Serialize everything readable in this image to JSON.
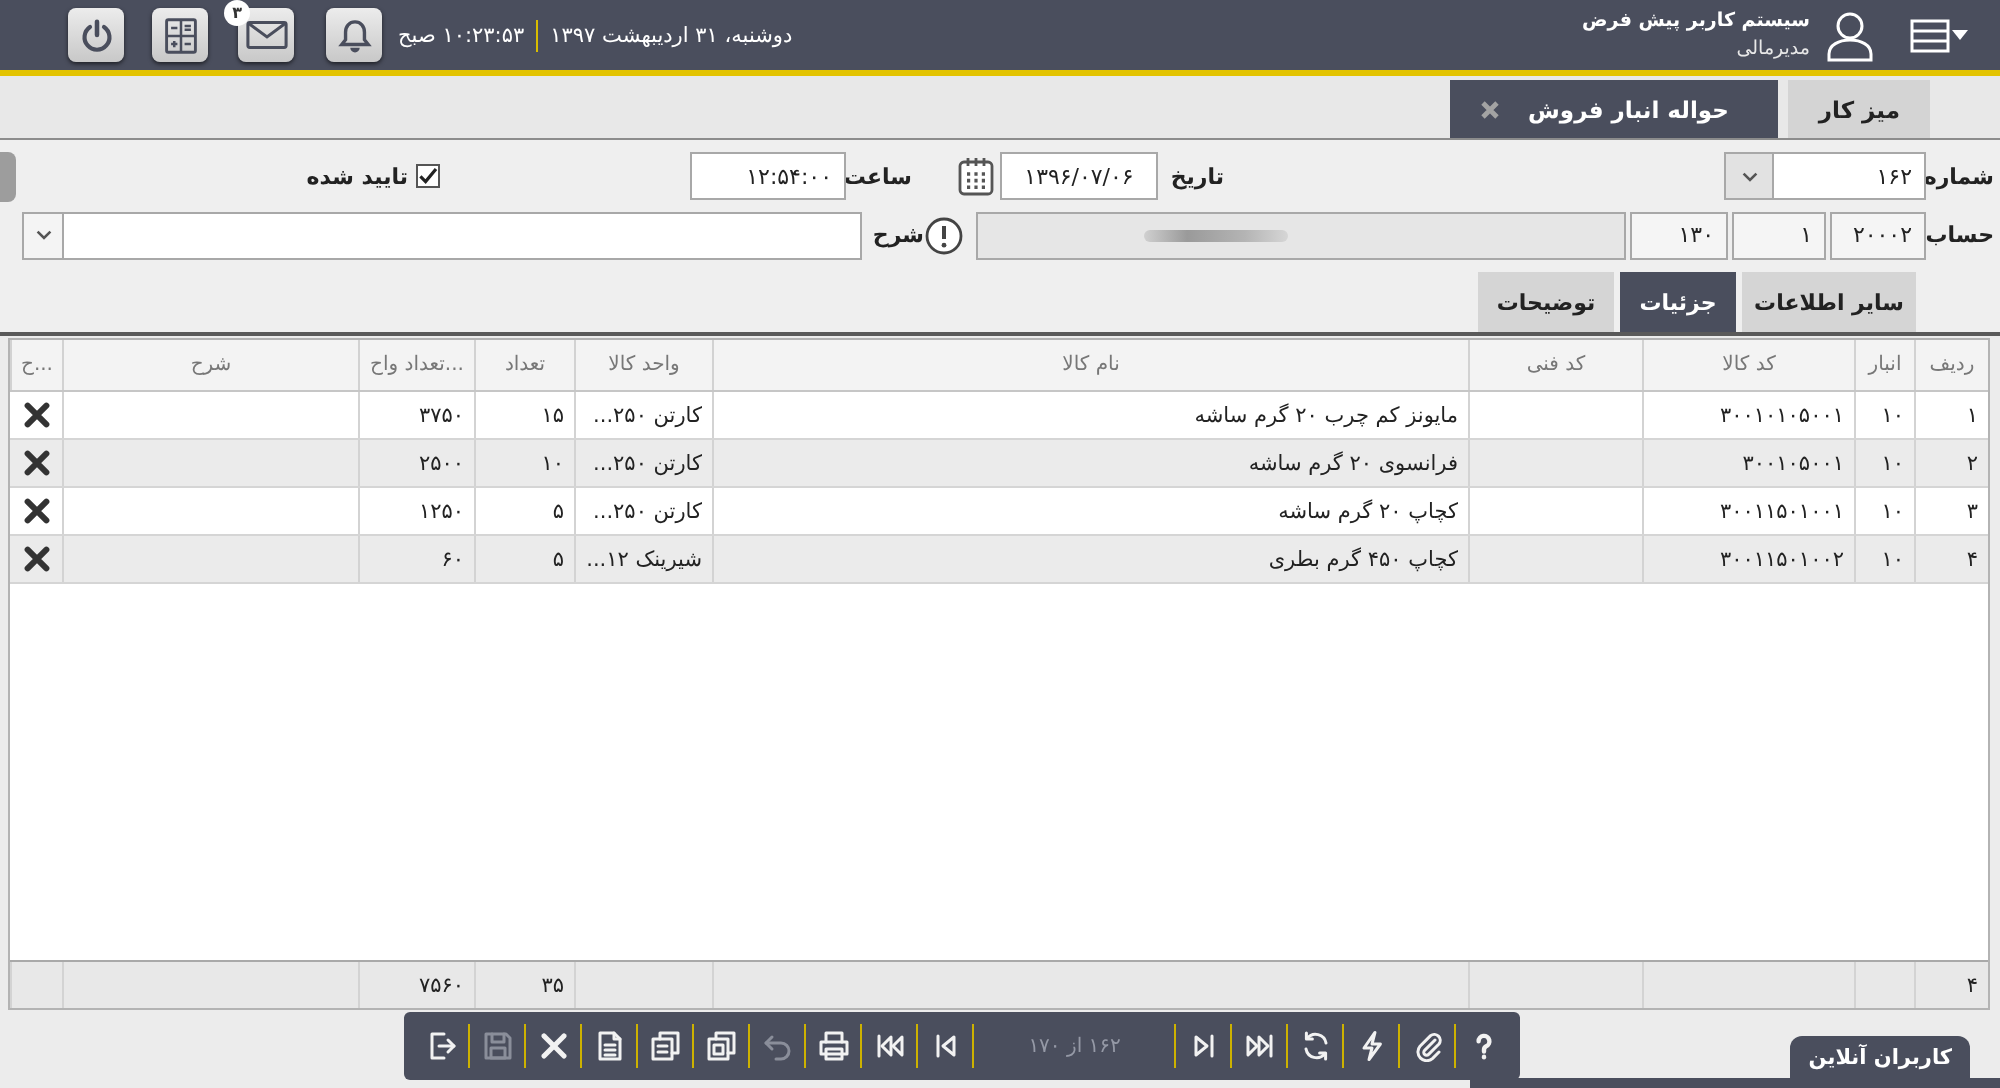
{
  "header": {
    "user_name": "سیستم کاربر پیش فرض",
    "user_role": "مدیرمالی",
    "date": "دوشنبه، ۳۱ اردیبهشت ۱۳۹۷",
    "time": "۱۰:۲۳:۵۳ صبح",
    "mail_badge": "۳"
  },
  "main_tabs": [
    {
      "label": "میز کار",
      "selected": false,
      "closable": false
    },
    {
      "label": "حواله انبار فروش",
      "selected": true,
      "closable": true
    }
  ],
  "form": {
    "number": {
      "label": "شماره",
      "value": "۱۶۲"
    },
    "date": {
      "label": "تاریخ",
      "value": "۱۳۹۶/۰۷/۰۶"
    },
    "time": {
      "label": "ساعت",
      "value": "۱۲:۵۴:۰۰"
    },
    "approved": {
      "label": "تایید شده",
      "checked": true
    },
    "account": {
      "label": "حساب",
      "codes": [
        "۲۰۰۰۲",
        "۱",
        "۱۳۰"
      ]
    },
    "description": {
      "label": "شرح"
    }
  },
  "detail_tabs": [
    {
      "label": "سایر اطلاعات",
      "selected": false
    },
    {
      "label": "جزئیات",
      "selected": true
    },
    {
      "label": "توضیحات",
      "selected": false
    }
  ],
  "table": {
    "columns": [
      "ردیف",
      "انبار",
      "کد کالا",
      "کد فنی",
      "نام کالا",
      "واحد کالا",
      "تعداد",
      "تعداد واح...",
      "شرح",
      "ح..."
    ],
    "rows": [
      {
        "row": "۱",
        "warehouse": "۱۰",
        "item_code": "۳۰۰۱۰۱۰۵۰۰۱",
        "item_name": "مایونز کم چرب ۲۰ گرم ساشه",
        "unit": "کارتن ۲۵۰...",
        "quantity": "۱۵",
        "unit_count": "۳۷۵۰"
      },
      {
        "row": "۲",
        "warehouse": "۱۰",
        "item_code": "۳۰۰۱۰۵۰۰۱",
        "item_name": "فرانسوی ۲۰ گرم ساشه",
        "unit": "کارتن ۲۵۰...",
        "quantity": "۱۰",
        "unit_count": "۲۵۰۰"
      },
      {
        "row": "۳",
        "warehouse": "۱۰",
        "item_code": "۳۰۰۱۱۵۰۱۰۰۱",
        "item_name": "کچاپ ۲۰ گرم ساشه",
        "unit": "کارتن ۲۵۰...",
        "quantity": "۵",
        "unit_count": "۱۲۵۰"
      },
      {
        "row": "۴",
        "warehouse": "۱۰",
        "item_code": "۳۰۰۱۱۵۰۱۰۰۲",
        "item_name": "کچاپ ۴۵۰ گرم بطری",
        "unit": "شیرینک ۱۲...",
        "quantity": "۵",
        "unit_count": "۶۰"
      }
    ],
    "totals": {
      "row": "۴",
      "quantity": "۳۵",
      "unit_count": "۷۵۶۰"
    }
  },
  "toolbar": {
    "left": [
      {
        "kind": "exit",
        "disabled": false
      },
      {
        "kind": "save",
        "disabled": true
      },
      {
        "kind": "delete",
        "disabled": false
      },
      {
        "kind": "edit",
        "disabled": false
      },
      {
        "kind": "copy",
        "disabled": false
      },
      {
        "kind": "clone",
        "disabled": false
      },
      {
        "kind": "undo",
        "disabled": true
      },
      {
        "kind": "print",
        "disabled": false
      },
      {
        "kind": "first",
        "disabled": false
      },
      {
        "kind": "previous",
        "disabled": false
      }
    ],
    "position": "۱۶۲ از ۱۷۰",
    "right": [
      {
        "kind": "next",
        "disabled": false
      },
      {
        "kind": "last",
        "disabled": false
      },
      {
        "kind": "refresh",
        "disabled": false
      },
      {
        "kind": "action",
        "disabled": false
      },
      {
        "kind": "attach",
        "disabled": false
      },
      {
        "kind": "help",
        "disabled": false
      }
    ]
  },
  "online_users": {
    "label": "کاربران آنلاین"
  }
}
